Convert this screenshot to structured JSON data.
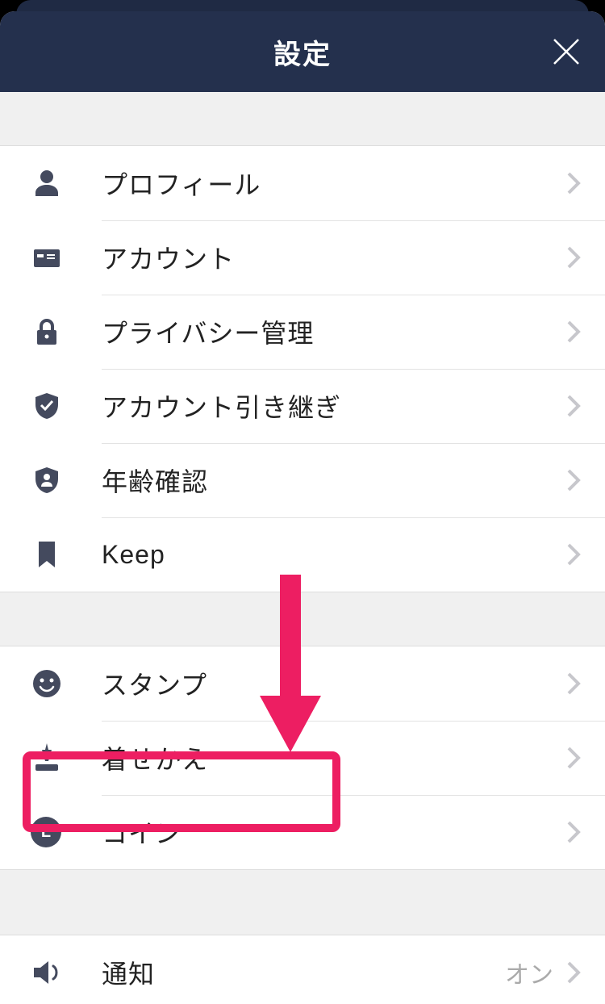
{
  "header": {
    "title": "設定"
  },
  "section1": {
    "items": [
      {
        "icon": "profile",
        "label": "プロフィール"
      },
      {
        "icon": "account",
        "label": "アカウント"
      },
      {
        "icon": "privacy",
        "label": "プライバシー管理"
      },
      {
        "icon": "transfer",
        "label": "アカウント引き継ぎ"
      },
      {
        "icon": "age",
        "label": "年齢確認"
      },
      {
        "icon": "keep",
        "label": "Keep"
      }
    ]
  },
  "section2": {
    "items": [
      {
        "icon": "stamp",
        "label": "スタンプ"
      },
      {
        "icon": "theme",
        "label": "着せかえ"
      },
      {
        "icon": "coin",
        "label": "コイン"
      }
    ]
  },
  "section3": {
    "items": [
      {
        "icon": "notify",
        "label": "通知",
        "value": "オン"
      }
    ]
  },
  "coin_letter": "L",
  "annotation": {
    "color": "#ed1e62",
    "target": "coin"
  }
}
